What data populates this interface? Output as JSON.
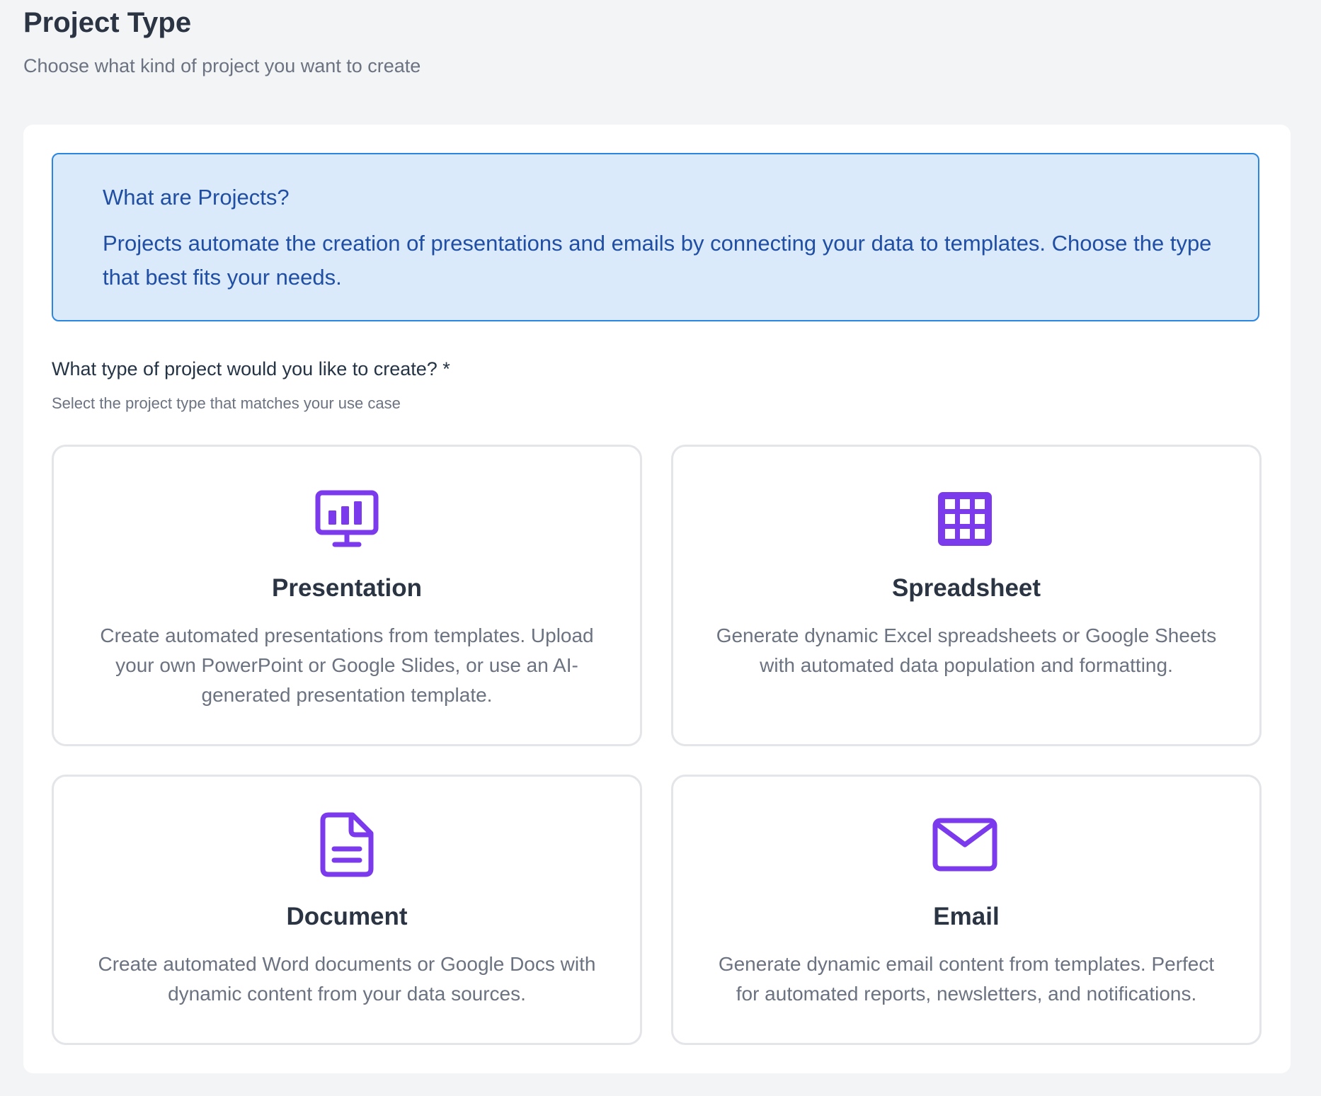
{
  "header": {
    "title": "Project Type",
    "subtitle": "Choose what kind of project you want to create"
  },
  "info": {
    "title": "What are Projects?",
    "text": "Projects automate the creation of presentations and emails by connecting your data to templates. Choose the type that best fits your needs."
  },
  "question": {
    "label": "What type of project would you like to create? *",
    "hint": "Select the project type that matches your use case"
  },
  "accent_color": "#7c3aed",
  "project_types": [
    {
      "icon": "presentation-icon",
      "title": "Presentation",
      "description": "Create automated presentations from templates. Upload your own PowerPoint or Google Slides, or use an AI-generated presentation template."
    },
    {
      "icon": "spreadsheet-icon",
      "title": "Spreadsheet",
      "description": "Generate dynamic Excel spreadsheets or Google Sheets with automated data population and formatting."
    },
    {
      "icon": "document-icon",
      "title": "Document",
      "description": "Create automated Word documents or Google Docs with dynamic content from your data sources."
    },
    {
      "icon": "email-icon",
      "title": "Email",
      "description": "Generate dynamic email content from templates. Perfect for automated reports, newsletters, and notifications."
    }
  ]
}
